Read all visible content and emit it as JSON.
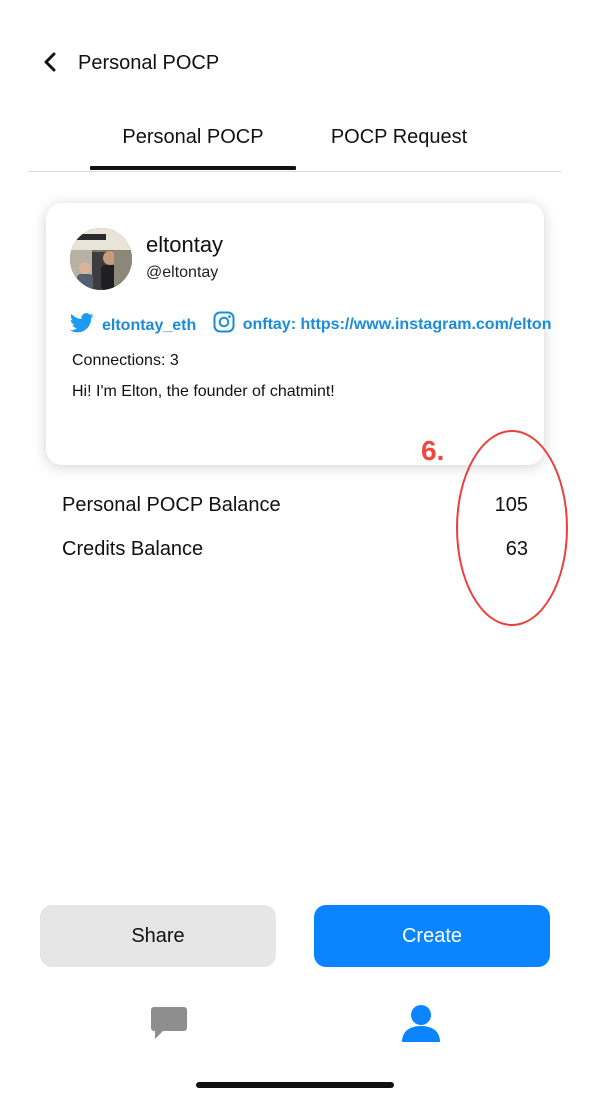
{
  "header": {
    "title": "Personal POCP",
    "back_icon": "chevron-left-icon"
  },
  "tabs": [
    {
      "label": "Personal POCP",
      "active": true
    },
    {
      "label": "POCP Request",
      "active": false
    }
  ],
  "profile": {
    "username": "eltontay",
    "handle": "@eltontay",
    "twitter": {
      "icon": "twitter-icon",
      "label": "eltontay_eth",
      "color": "#1a8cd8"
    },
    "instagram": {
      "icon": "instagram-icon",
      "label": "onftay: https://www.instagram.com/elton"
    },
    "connections": "Connections: 3",
    "bio": "Hi! I'm Elton, the founder of chatmint!"
  },
  "annotation": {
    "label": "6.",
    "color": "#ee3d3a"
  },
  "stats": [
    {
      "label": "Personal POCP Balance",
      "value": "105"
    },
    {
      "label": "Credits Balance",
      "value": "63"
    }
  ],
  "actions": {
    "share_label": "Share",
    "create_label": "Create",
    "primary_color": "#0a84ff"
  },
  "tabbar": [
    {
      "icon": "chat-icon",
      "active": false
    },
    {
      "icon": "person-icon",
      "active": true
    }
  ]
}
